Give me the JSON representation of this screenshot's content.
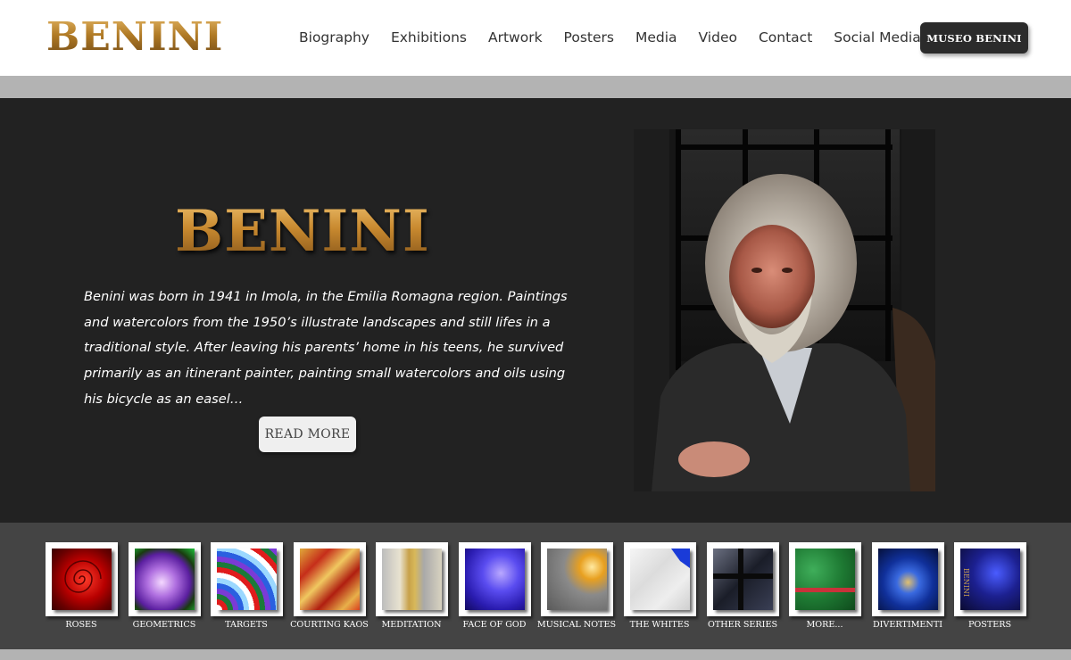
{
  "header": {
    "logo": "BENINI",
    "nav": [
      "Biography",
      "Exhibitions",
      "Artwork",
      "Posters",
      "Media",
      "Video",
      "Contact",
      "Social Media"
    ],
    "museo_button": "MUSEO BENINI"
  },
  "hero": {
    "logo": "BENINI",
    "bio": "Benini was born in 1941 in Imola, in the Emilia Romagna region. Paintings and watercolors from the 1950’s illustrate landscapes and still lifes in a traditional style. After leaving his parents’ home in his teens, he survived primarily as an itinerant painter, painting small watercolors and oils using his bicycle as an easel…",
    "read_more": "READ MORE"
  },
  "gallery": [
    {
      "label": "ROSES"
    },
    {
      "label": "GEOMETRICS"
    },
    {
      "label": "TARGETS"
    },
    {
      "label": "COURTING KAOS"
    },
    {
      "label": "MEDITATION"
    },
    {
      "label": "FACE OF GOD"
    },
    {
      "label": "MUSICAL NOTES"
    },
    {
      "label": "THE WHITES"
    },
    {
      "label": "OTHER SERIES"
    },
    {
      "label": "MORE..."
    },
    {
      "label": "DIVERTIMENTI"
    },
    {
      "label": "POSTERS",
      "art_text": "BENINI"
    }
  ]
}
